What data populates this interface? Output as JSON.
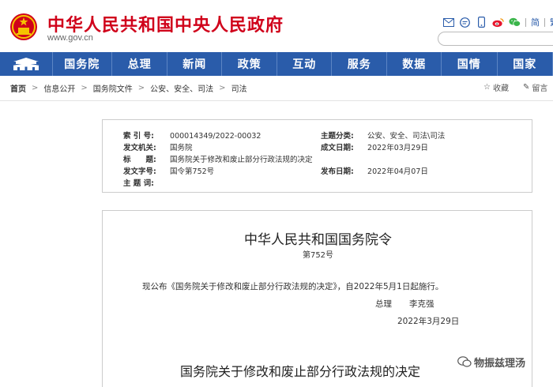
{
  "header": {
    "title": "中华人民共和国中央人民政府",
    "url": "www.gov.cn",
    "lang_simplified": "简",
    "lang_traditional": "繁",
    "icons": [
      "mail-icon",
      "chat-icon",
      "phone-icon",
      "weibo-icon",
      "wechat-icon"
    ],
    "colors": {
      "brand_red": "#d0021b",
      "nav_blue": "#2a5caa"
    }
  },
  "nav": {
    "home_icon": "tiananmen-icon",
    "items": [
      "国务院",
      "总理",
      "新闻",
      "政策",
      "互动",
      "服务",
      "数据",
      "国情",
      "国家"
    ]
  },
  "breadcrumb": {
    "items": [
      "首页",
      "信息公开",
      "国务院文件",
      "公安、安全、司法",
      "司法"
    ],
    "actions": {
      "favorite": "收藏",
      "comment": "留言"
    }
  },
  "info": {
    "index_label": "索 引 号:",
    "index_value": "000014349/2022-00032",
    "category_label": "主题分类:",
    "category_value": "公安、安全、司法\\司法",
    "issuer_label": "发文机关:",
    "issuer_value": "国务院",
    "created_label": "成文日期:",
    "created_value": "2022年03月29日",
    "title_label": "标　　题:",
    "title_value": "国务院关于修改和废止部分行政法规的决定",
    "doc_number_label": "发文字号:",
    "doc_number_value": "国令第752号",
    "published_label": "发布日期:",
    "published_value": "2022年04月07日",
    "keywords_label": "主 题 词:",
    "keywords_value": ""
  },
  "document": {
    "title": "中华人民共和国国务院令",
    "number": "第752号",
    "body": "现公布《国务院关于修改和废止部分行政法规的决定》，自2022年5月1日起施行。",
    "sign_role": "总理",
    "sign_name": "李克强",
    "date": "2022年3月29日",
    "decision_title": "国务院关于修改和废止部分行政法规的决定"
  },
  "watermark": {
    "text": "物振兹理汤"
  }
}
